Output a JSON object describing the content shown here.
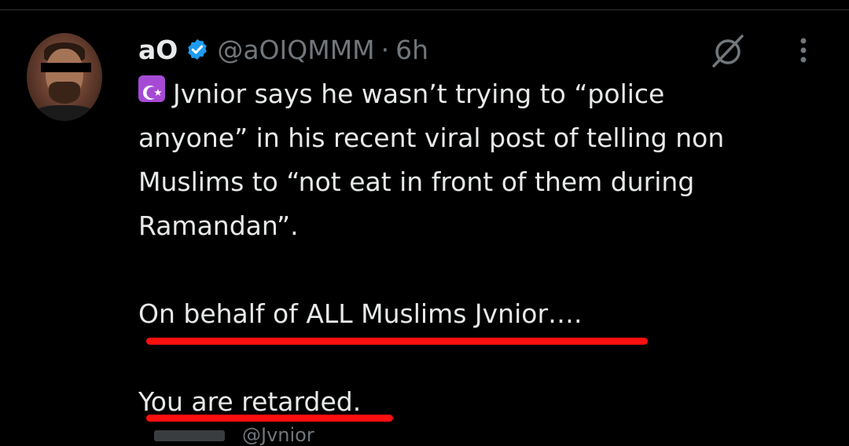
{
  "tweet": {
    "display_name": "aO",
    "handle": "@aOIQMMM",
    "separator": "·",
    "time": "6h",
    "text_lines": [
      "Jvnior says he wasn’t trying to “police",
      "anyone” in his recent viral post of telling non",
      "Muslims to “not eat in front of them during",
      "Ramandan”.",
      "On behalf of ALL Muslims Jvnior….",
      "You are retarded."
    ],
    "quoted_peek": "@Jvnior"
  },
  "icons": {
    "verified": "verified-badge-icon",
    "emoji": "star-and-crescent-emoji",
    "grok": "grok-icon",
    "more": "more-vertical-icon"
  },
  "colors": {
    "background": "#000000",
    "text": "#e7e9ea",
    "muted": "#71767b",
    "verified": "#1d9bf0",
    "emoji_bg": "#a64ad6",
    "annotation_underline": "#ff0f0f"
  }
}
